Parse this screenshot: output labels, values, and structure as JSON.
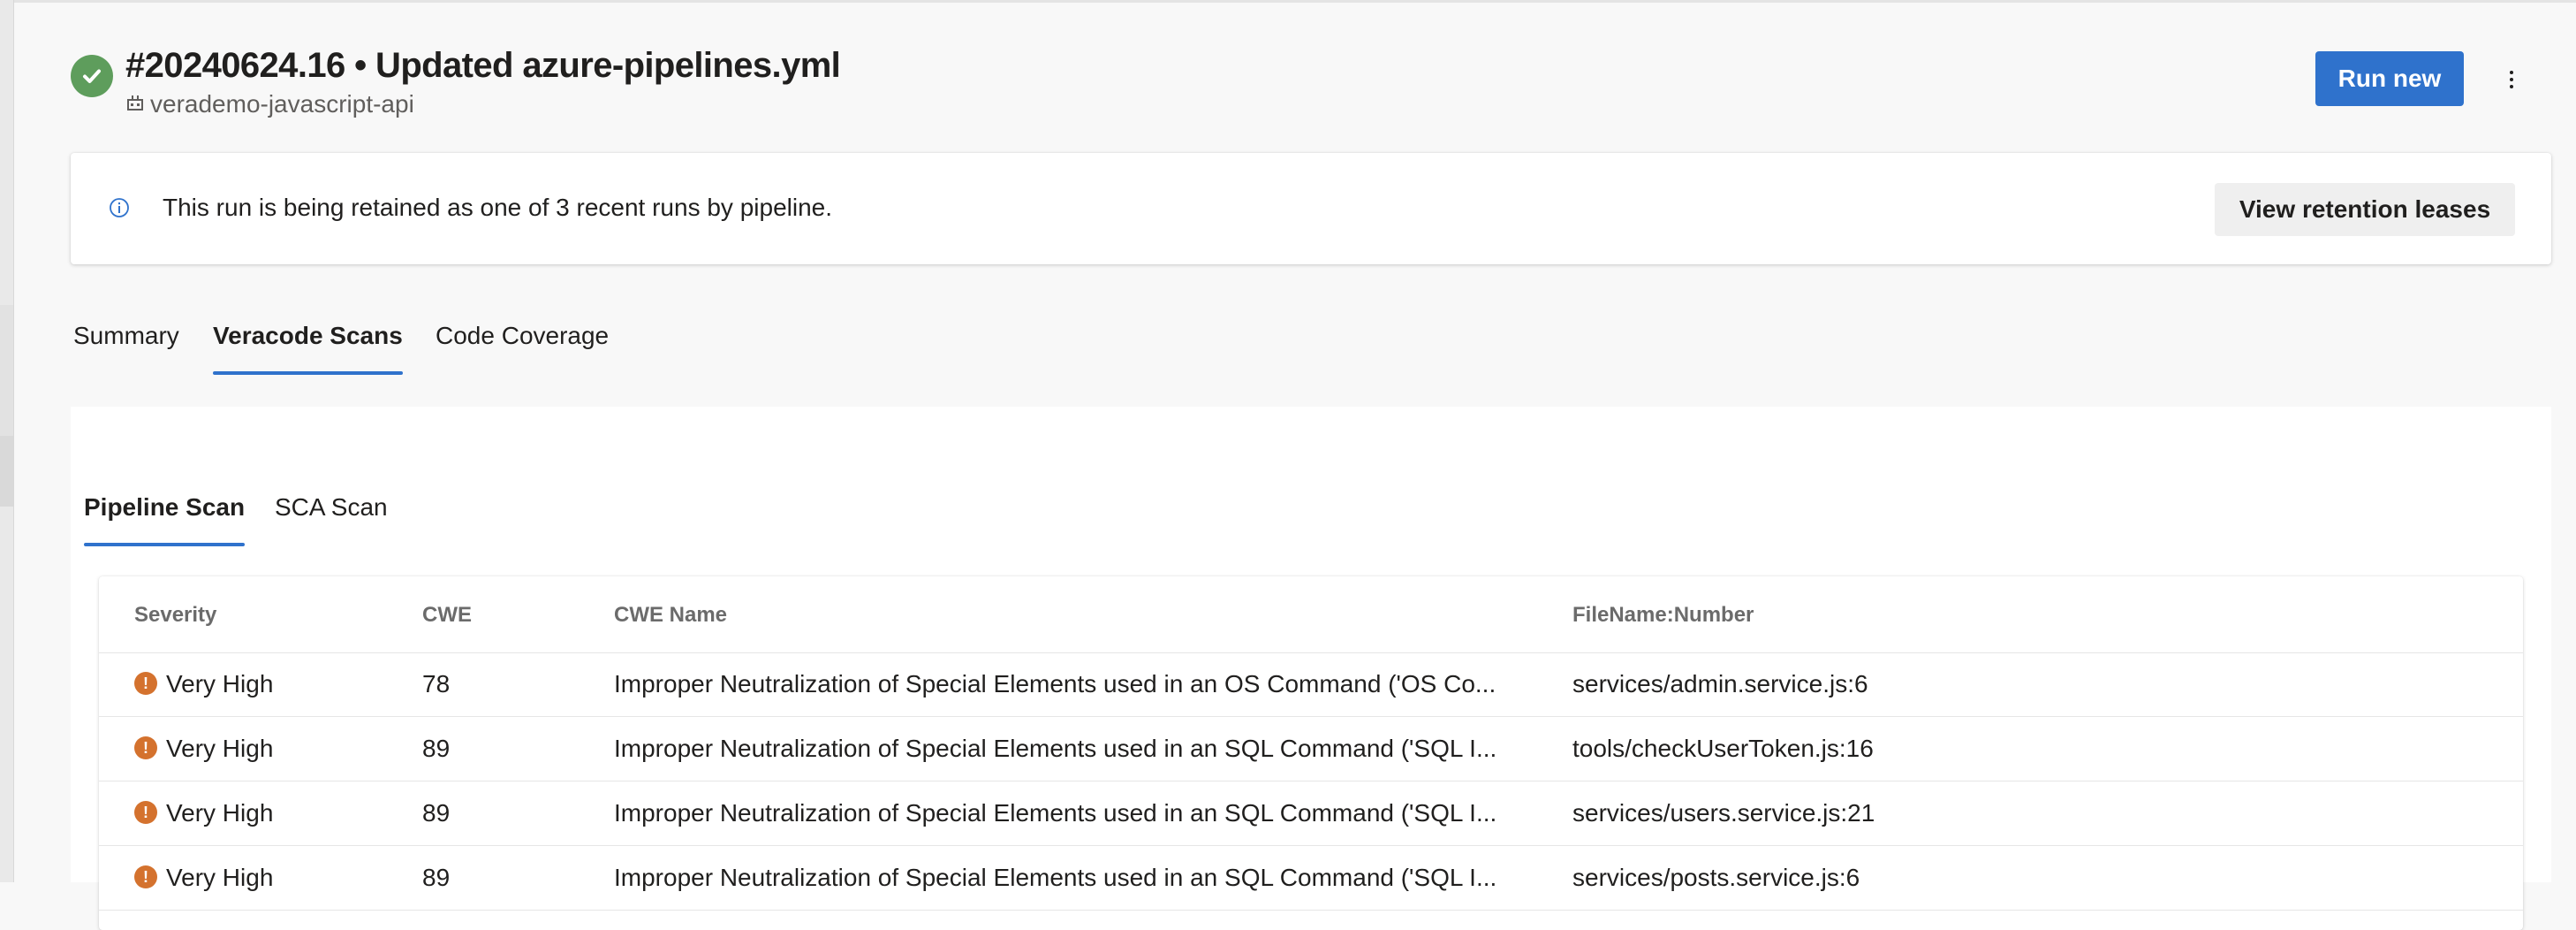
{
  "header": {
    "title": "#20240624.16 • Updated azure-pipelines.yml",
    "repo": "verademo-javascript-api",
    "run_new_label": "Run new",
    "status_icon": "check-circle-icon",
    "status_color": "#5e9d5c"
  },
  "banner": {
    "message": "This run is being retained as one of 3 recent runs by pipeline.",
    "button_label": "View retention leases"
  },
  "tabs": [
    {
      "label": "Summary",
      "active": false
    },
    {
      "label": "Veracode Scans",
      "active": true
    },
    {
      "label": "Code Coverage",
      "active": false
    }
  ],
  "subtabs": [
    {
      "label": "Pipeline Scan",
      "active": true
    },
    {
      "label": "SCA Scan",
      "active": false
    }
  ],
  "table": {
    "columns": [
      "Severity",
      "CWE",
      "CWE Name",
      "FileName:Number"
    ],
    "rows": [
      {
        "severity": "Very High",
        "cwe": "78",
        "name": "Improper Neutralization of Special Elements used in an OS Command ('OS Co...",
        "file": "services/admin.service.js:6"
      },
      {
        "severity": "Very High",
        "cwe": "89",
        "name": "Improper Neutralization of Special Elements used in an SQL Command ('SQL I...",
        "file": "tools/checkUserToken.js:16"
      },
      {
        "severity": "Very High",
        "cwe": "89",
        "name": "Improper Neutralization of Special Elements used in an SQL Command ('SQL I...",
        "file": "services/users.service.js:21"
      },
      {
        "severity": "Very High",
        "cwe": "89",
        "name": "Improper Neutralization of Special Elements used in an SQL Command ('SQL I...",
        "file": "services/posts.service.js:6"
      }
    ]
  },
  "colors": {
    "accent": "#2f72cc",
    "severity_very_high": "#d4722e"
  }
}
